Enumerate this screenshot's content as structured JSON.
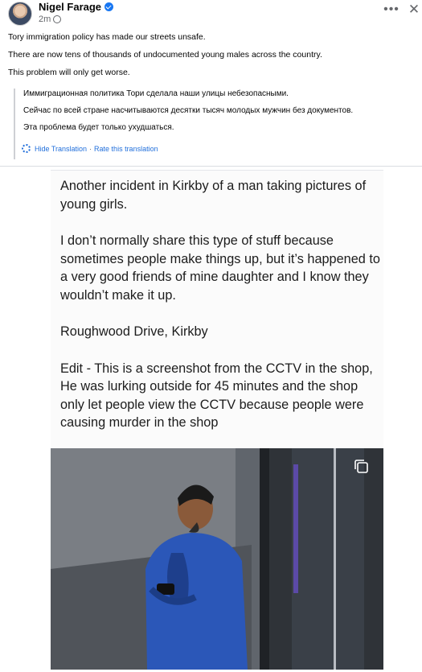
{
  "post": {
    "author": "Nigel Farage",
    "time": "2m",
    "more_icon": "more-dots-icon",
    "close_icon": "close-icon",
    "original_lines": [
      "Tory immigration policy has made our streets unsafe.",
      "There are now tens of thousands of undocumented young males across the country.",
      "This problem will only get worse."
    ],
    "translation_lines": [
      "Иммиграционная политика Тори сделала наши улицы небезопасными.",
      "Сейчас по всей стране насчитываются десятки тысяч молодых мужчин без документов.",
      "Эта проблема будет только ухудшаться."
    ],
    "hide_translation": "Hide Translation",
    "separator": "·",
    "rate_translation": "Rate this translation"
  },
  "screenshot": {
    "paragraphs": [
      "Another incident in Kirkby of a man taking pictures of young girls.",
      "I don’t normally share this type of stuff because sometimes people make things up, but it’s happened to a very good friends of mine daughter and I know they wouldn’t make it up.",
      "Roughwood Drive, Kirkby",
      "Edit - This is a screenshot from the CCTV in the shop, He was lurking outside for 45 minutes and the shop only let people view the CCTV because people were causing murder in the shop"
    ]
  },
  "colors": {
    "link": "#216fdb",
    "verified": "#1877f2",
    "secondary_text": "#65676b"
  }
}
